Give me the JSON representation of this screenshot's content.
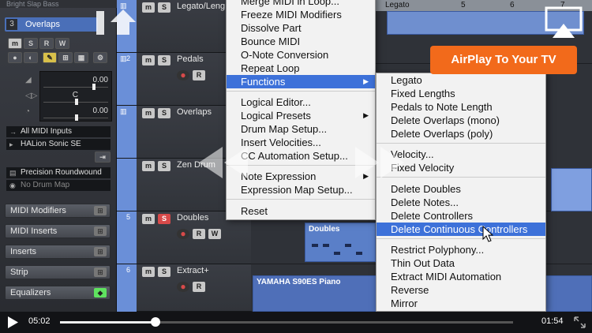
{
  "inspector": {
    "top_label": "Bright Slap Bass",
    "track_name": "Overlaps",
    "track_number": "3",
    "value1": "0.00",
    "value2": "C",
    "value3": "0.00",
    "input": "All MIDI Inputs",
    "output": "HALion Sonic SE",
    "program": "Precision Roundwound",
    "drum_map": "No Drum Map",
    "sections": [
      "MIDI Modifiers",
      "MIDI Inserts",
      "Inserts",
      "Strip",
      "Equalizers"
    ]
  },
  "tracks": [
    {
      "num": "1",
      "name": "Legato/Leng"
    },
    {
      "num": "2",
      "name": "Pedals"
    },
    {
      "num": "3",
      "name": "Overlaps"
    },
    {
      "num": "4",
      "name": "Zen Drum"
    },
    {
      "num": "5",
      "name": "Doubles"
    },
    {
      "num": "6",
      "name": "Extract+"
    }
  ],
  "ruler": [
    "Legato",
    "5",
    "6",
    "7"
  ],
  "parts": {
    "doubles": "Doubles",
    "yamaha": "YAMAHA S90ES Piano"
  },
  "menu": {
    "items": [
      "Merge MIDI in Loop...",
      "Freeze MIDI Modifiers",
      "Dissolve Part",
      "Bounce MIDI",
      "O-Note Conversion",
      "Repeat Loop",
      "Functions",
      "Logical Editor...",
      "Logical Presets",
      "Drum Map Setup...",
      "Insert Velocities...",
      "CC Automation Setup...",
      "Note Expression",
      "Expression Map Setup...",
      "Reset"
    ]
  },
  "submenu": {
    "items": [
      "Legato",
      "Fixed Lengths",
      "Pedals to Note Length",
      "Delete Overlaps (mono)",
      "Delete Overlaps (poly)",
      "Velocity...",
      "Fixed Velocity",
      "Delete Doubles",
      "Delete Notes...",
      "Delete Controllers",
      "Delete Continuous Controllers",
      "Restrict Polyphony...",
      "Thin Out Data",
      "Extract MIDI Automation",
      "Reverse",
      "Mirror"
    ]
  },
  "airplay": {
    "label": "AirPlay To Your TV"
  },
  "player": {
    "elapsed": "05:02",
    "remaining": "01:54",
    "progress": 0.21
  },
  "colors": {
    "highlight": "#3d71d9",
    "airplay": "#f26a1b",
    "track": "#6a8fd8"
  }
}
